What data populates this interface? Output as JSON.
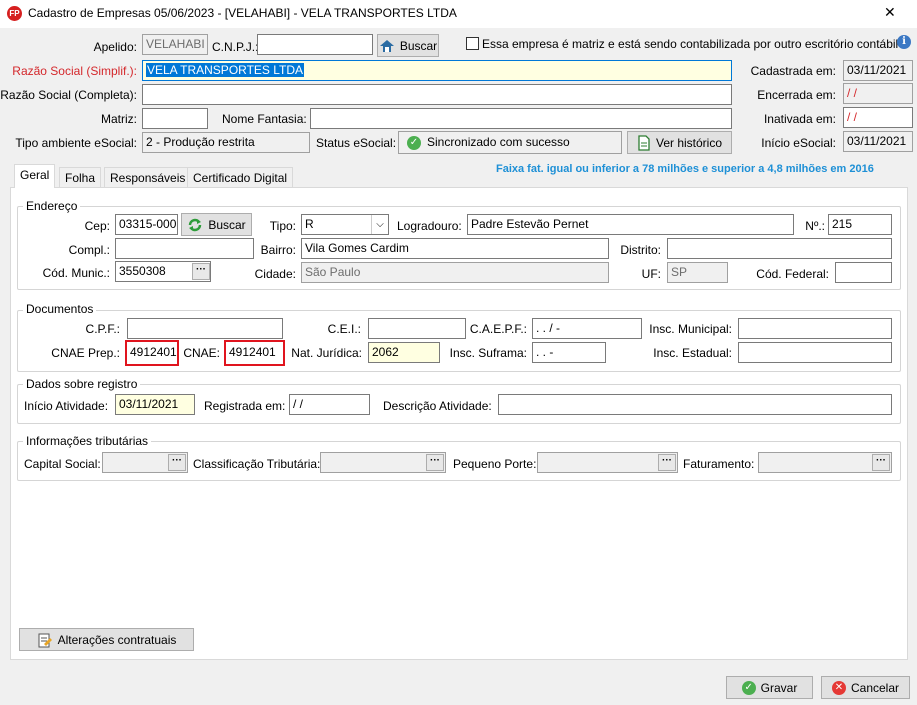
{
  "window": {
    "title": "Cadastro de Empresas  05/06/2023 - [VELAHABI] - VELA TRANSPORTES LTDA",
    "logo": "FP",
    "close_glyph": "✕"
  },
  "header": {
    "apelido_label": "Apelido:",
    "apelido_value": "VELAHABI",
    "cnpj_label": "C.N.P.J.:",
    "cnpj_value": "",
    "buscar_label": "Buscar",
    "matriz_checkbox_label": "Essa empresa é matriz e está sendo contabilizada por outro escritório contábil",
    "razao_simpl_label": "Razão Social (Simplif.):",
    "razao_simpl_value": "VELA TRANSPORTES LTDA",
    "razao_compl_label": "Razão Social (Completa):",
    "razao_compl_value": "",
    "matriz_label": "Matriz:",
    "matriz_value": "",
    "nome_fantasia_label": "Nome Fantasia:",
    "nome_fantasia_value": "",
    "tipo_ambiente_label": "Tipo ambiente eSocial:",
    "tipo_ambiente_value": "2 - Produção restrita",
    "status_esocial_label": "Status eSocial:",
    "status_esocial_value": "Sincronizado com sucesso",
    "ver_historico_label": "Ver histórico",
    "cadastrada_label": "Cadastrada em:",
    "cadastrada_value": "03/11/2021",
    "encerrada_label": "Encerrada em:",
    "encerrada_value": " /  /",
    "inativada_label": "Inativada em:",
    "inativada_value": " /  /",
    "inicio_esocial_label": "Início eSocial:",
    "inicio_esocial_value": "03/11/2021"
  },
  "tabs": [
    {
      "label": "Geral"
    },
    {
      "label": "Folha"
    },
    {
      "label": "Responsáveis"
    },
    {
      "label": "Certificado Digital"
    }
  ],
  "faixa_text": "Faixa fat. igual ou inferior a 78 milhões e superior a 4,8 milhões em 2016",
  "endereco": {
    "title": "Endereço",
    "cep_label": "Cep:",
    "cep_value": "03315-000",
    "buscar_label": "Buscar",
    "tipo_label": "Tipo:",
    "tipo_value": "R",
    "logradouro_label": "Logradouro:",
    "logradouro_value": "Padre Estevão Pernet",
    "numero_label": "Nº.:",
    "numero_value": "215",
    "compl_label": "Compl.:",
    "compl_value": "",
    "bairro_label": "Bairro:",
    "bairro_value": "Vila Gomes Cardim",
    "distrito_label": "Distrito:",
    "distrito_value": "",
    "cod_munic_label": "Cód. Munic.:",
    "cod_munic_value": "3550308",
    "cidade_label": "Cidade:",
    "cidade_value": "São Paulo",
    "uf_label": "UF:",
    "uf_value": "SP",
    "cod_federal_label": "Cód. Federal:",
    "cod_federal_value": ""
  },
  "documentos": {
    "title": "Documentos",
    "cpf_label": "C.P.F.:",
    "cpf_value": "",
    "cei_label": "C.E.I.:",
    "cei_value": "",
    "caepf_label": "C.A.E.P.F.:",
    "caepf_value": " .  .  /  -",
    "insc_municipal_label": "Insc. Municipal:",
    "insc_municipal_value": "",
    "cnae_prep_label": "CNAE Prep.:",
    "cnae_prep_value": "4912401",
    "cnae_label": "CNAE:",
    "cnae_value": "4912401",
    "nat_juridica_label": "Nat. Jurídica:",
    "nat_juridica_value": "2062",
    "insc_suframa_label": "Insc. Suframa:",
    "insc_suframa_value": " .  .  -",
    "insc_estadual_label": "Insc. Estadual:",
    "insc_estadual_value": ""
  },
  "registro": {
    "title": "Dados sobre registro",
    "inicio_atividade_label": "Início Atividade:",
    "inicio_atividade_value": "03/11/2021",
    "registrada_label": "Registrada em:",
    "registrada_value": " /  /",
    "descricao_label": "Descrição Atividade:",
    "descricao_value": ""
  },
  "tributarias": {
    "title": "Informações tributárias",
    "capital_social_label": "Capital Social:",
    "classificacao_label": "Classificação Tributária:",
    "pequeno_porte_label": "Pequeno Porte:",
    "faturamento_label": "Faturamento:",
    "ellipsis": "···"
  },
  "footer": {
    "alteracoes_label": "Alterações contratuais",
    "gravar_label": "Gravar",
    "cancelar_label": "Cancelar"
  },
  "colors": {
    "accent": "#0078d7",
    "required_label": "#d4272b",
    "highlight_box": "#e0141e",
    "faixa_text": "#1e90d6",
    "logo_bg": "#d62020"
  }
}
